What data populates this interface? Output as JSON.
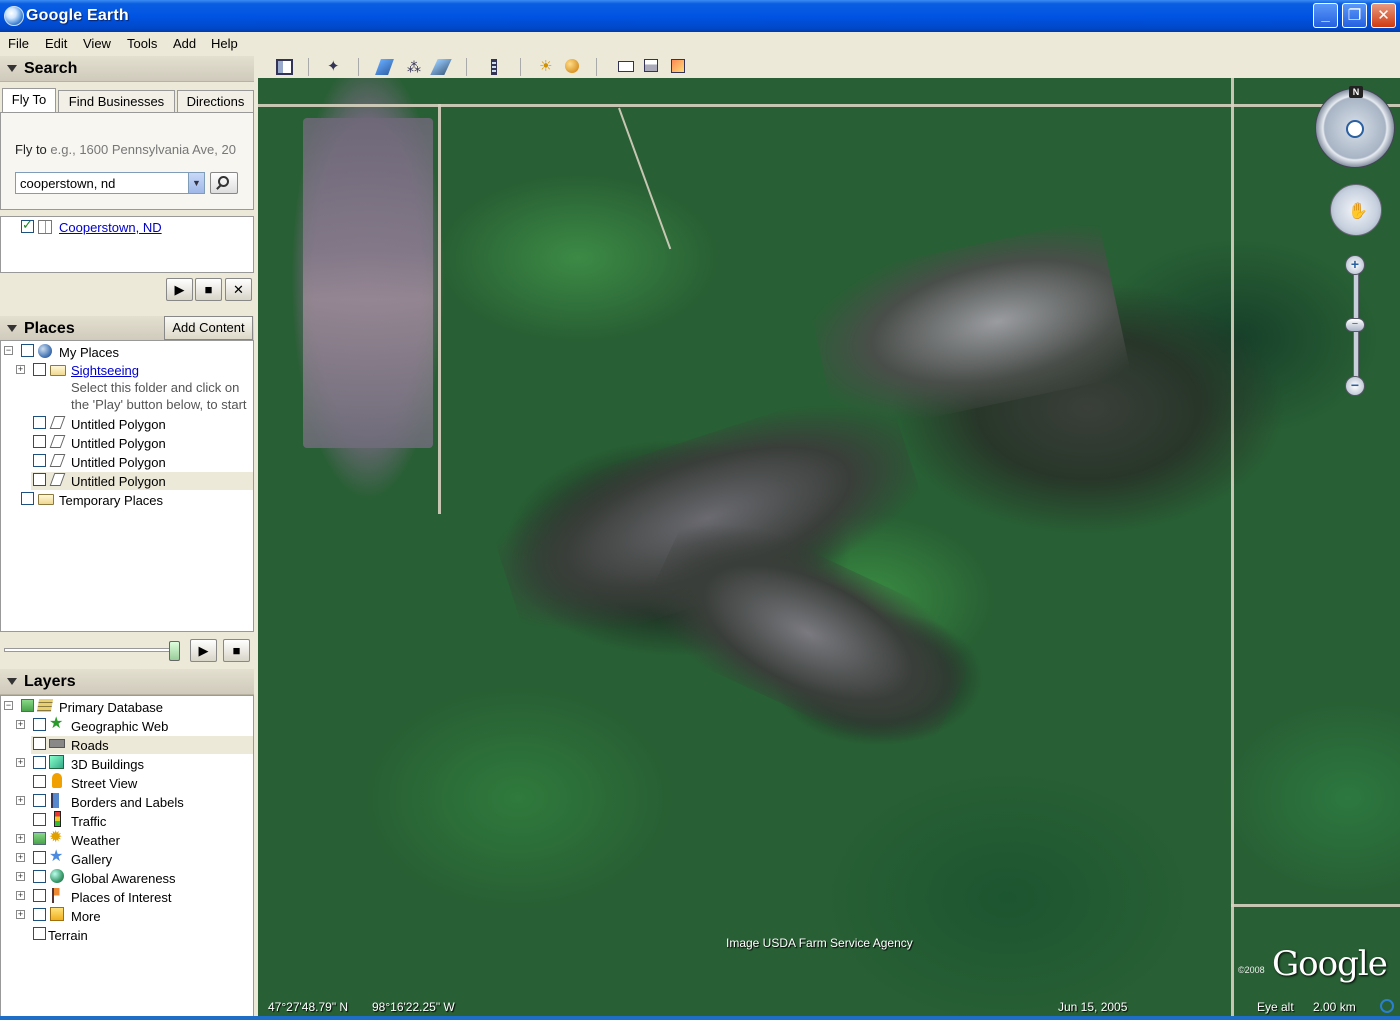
{
  "window": {
    "title": "Google Earth",
    "minimize": "_",
    "maximize": "❐",
    "close": "✕"
  },
  "menu": [
    "File",
    "Edit",
    "View",
    "Tools",
    "Add",
    "Help"
  ],
  "search": {
    "header": "Search",
    "tabs": [
      "Fly To",
      "Find Businesses",
      "Directions"
    ],
    "fly_to_label": "Fly to",
    "fly_to_placeholder": "e.g., 1600 Pennsylvania Ave, 20",
    "query": "cooperstown, nd",
    "result": "Cooperstown, ND"
  },
  "places": {
    "header": "Places",
    "add_content": "Add Content",
    "my_places": "My Places",
    "sightseeing": "Sightseeing",
    "sightseeing_hint_1": "Select this folder and click on",
    "sightseeing_hint_2": "the 'Play' button below, to start",
    "polygons": [
      "Untitled Polygon",
      "Untitled Polygon",
      "Untitled Polygon",
      "Untitled Polygon"
    ],
    "temporary": "Temporary Places"
  },
  "layers": {
    "header": "Layers",
    "items": [
      "Primary Database",
      "Geographic Web",
      "Roads",
      "3D Buildings",
      "Street View",
      "Borders and Labels",
      "Traffic",
      "Weather",
      "Gallery",
      "Global Awareness",
      "Places of Interest",
      "More",
      "Terrain"
    ]
  },
  "map": {
    "imagery_credit": "Image USDA Farm Service Agency",
    "logo": "Google",
    "copyright": "©2008",
    "north_label": "N",
    "zoom_in": "+",
    "zoom_out": "−",
    "latitude": "47°27'48.79\" N",
    "longitude": "98°16'22.25\" W",
    "date": "Jun 15, 2005",
    "eye_alt_label": "Eye alt",
    "eye_alt_value": "2.00 km"
  },
  "controls": {
    "play": "▶",
    "stop": "■",
    "close": "✕"
  }
}
